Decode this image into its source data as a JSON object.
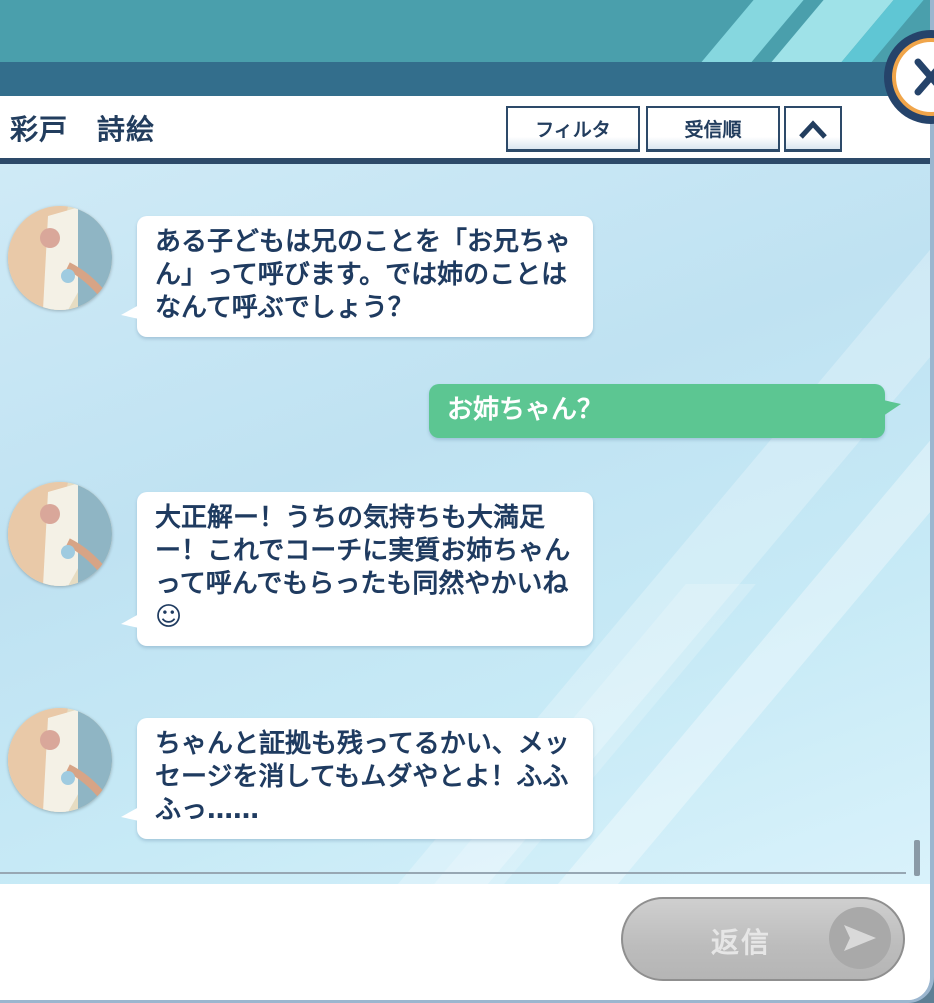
{
  "header": {
    "title": "彩戸　詩絵",
    "filter_label": "フィルタ",
    "sort_label": "受信順"
  },
  "messages": [
    {
      "from": "other",
      "text": "ある子どもは兄のことを「お兄ちゃん」って呼びます。では姉のことはなんて呼ぶでしょう？"
    },
    {
      "from": "me",
      "text": "お姉ちゃん？"
    },
    {
      "from": "other",
      "text": "大正解ー！うちの気持ちも大満足ー！これでコーチに実質お姉ちゃんって呼んでもらったも同然やかいね☺"
    },
    {
      "from": "other",
      "text": "ちゃんと証拠も残ってるかい、メッセージを消してもムダやとよ！ふふふっ……"
    }
  ],
  "footer": {
    "reply_label": "返信"
  },
  "icons": {
    "close": "close-icon",
    "collapse": "chevron-up-icon",
    "send": "send-arrow-icon"
  },
  "colors": {
    "accent_green": "#5cc692",
    "header_navy": "#2d4a69",
    "text_navy": "#1f3b60",
    "close_ring": "#f0a54a"
  }
}
